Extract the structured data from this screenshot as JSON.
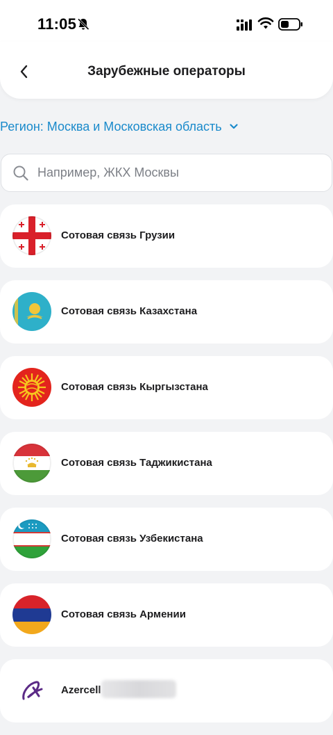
{
  "status_bar": {
    "time": "11:05",
    "icons": [
      "bell-slash-icon",
      "signal-icon",
      "wifi-icon",
      "battery-icon"
    ]
  },
  "header": {
    "title": "Зарубежные операторы",
    "back_icon": "chevron-left-icon"
  },
  "region": {
    "label": "Регион: Москва и Московская область",
    "color": "#1a8acb"
  },
  "search": {
    "placeholder": "Например, ЖКХ Москвы",
    "value": ""
  },
  "operators": [
    {
      "name": "Сотовая связь Грузии",
      "icon": "georgia-flag-icon"
    },
    {
      "name": "Сотовая связь Казахстана",
      "icon": "kazakhstan-flag-icon"
    },
    {
      "name": "Сотовая связь Кыргызстана",
      "icon": "kyrgyzstan-flag-icon"
    },
    {
      "name": "Сотовая связь Таджикистана",
      "icon": "tajikistan-flag-icon"
    },
    {
      "name": "Сотовая связь Узбекистана",
      "icon": "uzbekistan-flag-icon"
    },
    {
      "name": "Сотовая связь Армении",
      "icon": "armenia-flag-icon"
    },
    {
      "name": "Azercell",
      "icon": "azercell-logo-icon"
    }
  ]
}
